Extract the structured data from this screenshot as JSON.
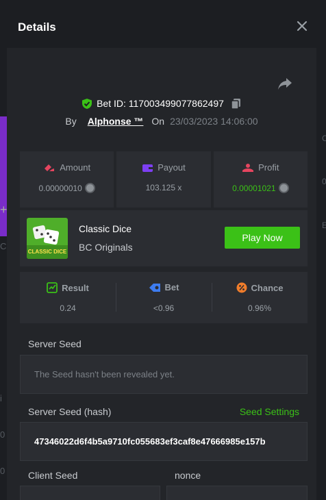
{
  "modal": {
    "title": "Details"
  },
  "bet": {
    "id_label": "Bet ID: 117003499077862497",
    "by_label": "By",
    "user": "Alphonse ™",
    "on_label": "On",
    "date": "23/03/2023 14:06:00"
  },
  "stats": [
    {
      "label": "Amount",
      "value": "0.00000010",
      "icon": "amount-icon",
      "color": "#e5455f"
    },
    {
      "label": "Payout",
      "value": "103.125 x",
      "icon": "wallet-icon",
      "color": "#7d3ff2"
    },
    {
      "label": "Profit",
      "value": "0.00001021",
      "icon": "profit-icon",
      "color": "#e5455f"
    }
  ],
  "game": {
    "name": "Classic Dice",
    "provider": "BC Originals",
    "thumb_text": "CLASSIC DICE",
    "play_label": "Play Now"
  },
  "result": [
    {
      "label": "Result",
      "value": "0.24",
      "icon": "result-icon",
      "color": "#3bc117"
    },
    {
      "label": "Bet",
      "value": "<0.96",
      "icon": "ticket-icon",
      "color": "#3d7cf0"
    },
    {
      "label": "Chance",
      "value": "0.96%",
      "icon": "percent-icon",
      "color": "#f07d2b"
    }
  ],
  "server_seed": {
    "label": "Server Seed",
    "value": "The Seed hasn't been revealed yet."
  },
  "server_hash": {
    "label": "Server Seed (hash)",
    "settings_label": "Seed Settings",
    "value": "47346022d6f4b5a9710fc055683ef3caf8e47666985e157b"
  },
  "client_seed": {
    "label": "Client Seed",
    "nonce_label": "nonce"
  },
  "colors": {
    "accent_green": "#3bc117",
    "panel": "#2b2d32",
    "modal_bg": "#232529"
  }
}
